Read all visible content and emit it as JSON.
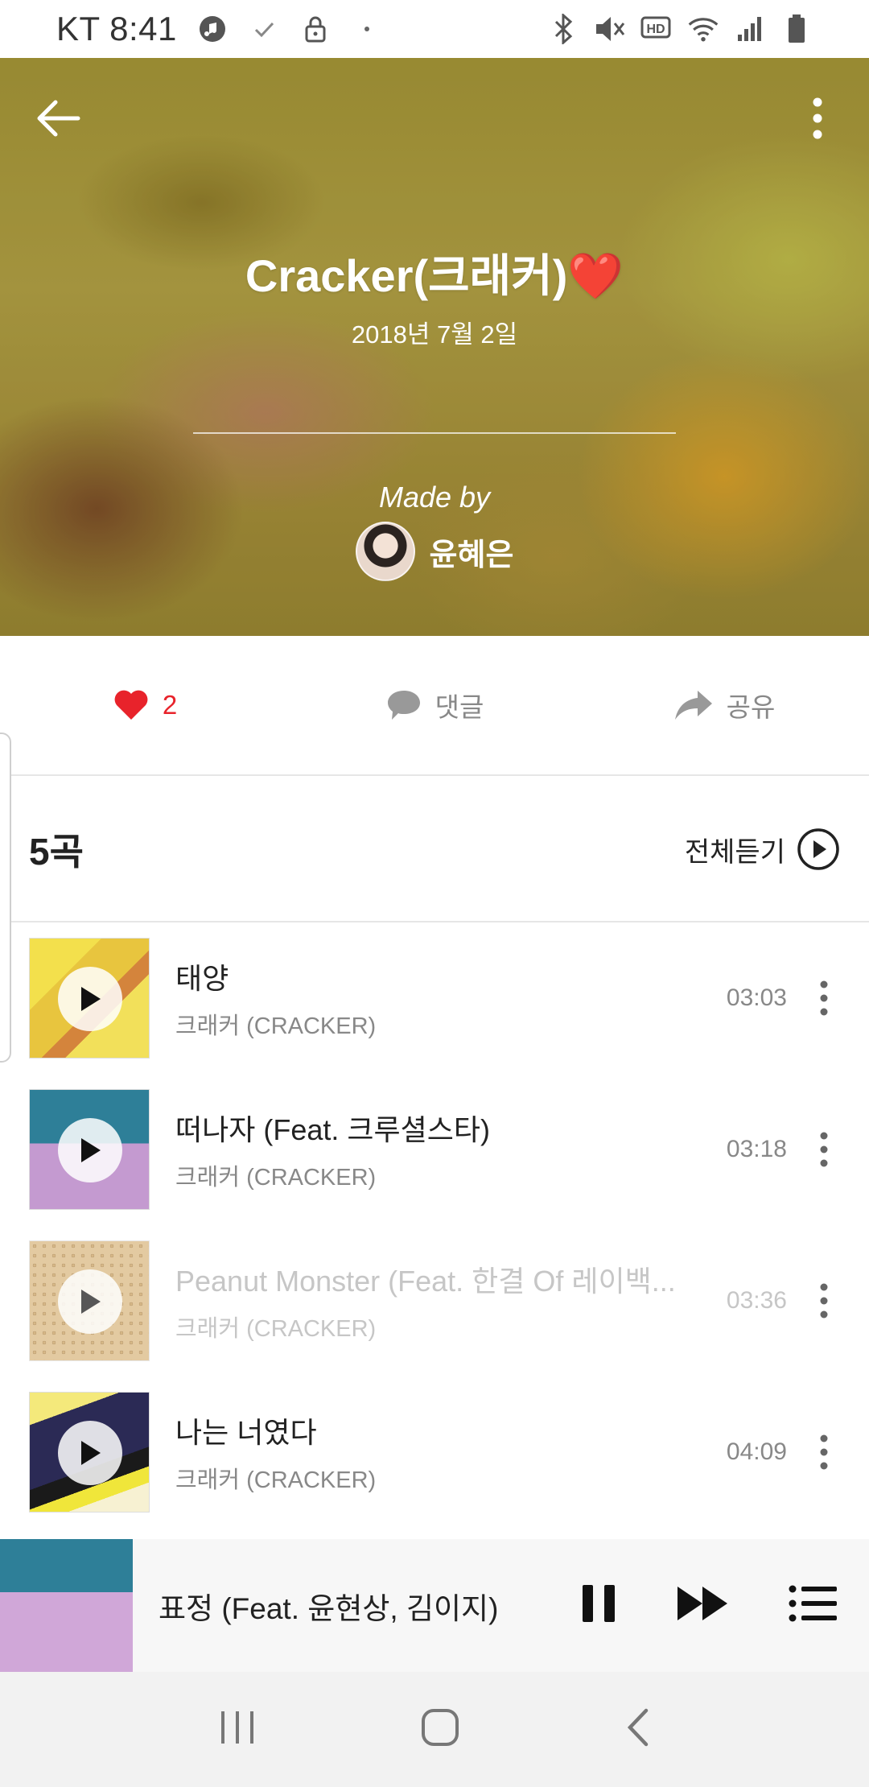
{
  "status_bar": {
    "carrier_time": "KT 8:41",
    "left_icons": [
      "music-app-icon",
      "check-icon",
      "lock-icon",
      "dot-icon"
    ],
    "right_icons": [
      "bluetooth-icon",
      "mute-icon",
      "hd-icon",
      "wifi-icon",
      "signal-icon",
      "battery-icon"
    ]
  },
  "header": {
    "title": "Cracker(크래커)",
    "title_emoji": "❤️",
    "date": "2018년 7월 2일",
    "made_by_label": "Made by",
    "author_name": "윤혜은"
  },
  "actions": {
    "like_count": "2",
    "comment_label": "댓글",
    "share_label": "공유"
  },
  "song_list": {
    "count_label": "5곡",
    "play_all_label": "전체듣기",
    "tracks": [
      {
        "title": "태양",
        "artist": "크래커 (CRACKER)",
        "duration": "03:03",
        "enabled": true
      },
      {
        "title": "떠나자 (Feat. 크루셜스타)",
        "artist": "크래커 (CRACKER)",
        "duration": "03:18",
        "enabled": true
      },
      {
        "title": "Peanut Monster (Feat. 한결 Of 레이백...",
        "artist": "크래커 (CRACKER)",
        "duration": "03:36",
        "enabled": false
      },
      {
        "title": "나는 너였다",
        "artist": "크래커 (CRACKER)",
        "duration": "04:09",
        "enabled": true
      }
    ]
  },
  "mini_player": {
    "now_playing_title": "표정 (Feat. 윤현상, 김이지)"
  },
  "colors": {
    "accent_red": "#e8232b",
    "muted_text": "#888888",
    "disabled_text": "#c6c6c6"
  }
}
